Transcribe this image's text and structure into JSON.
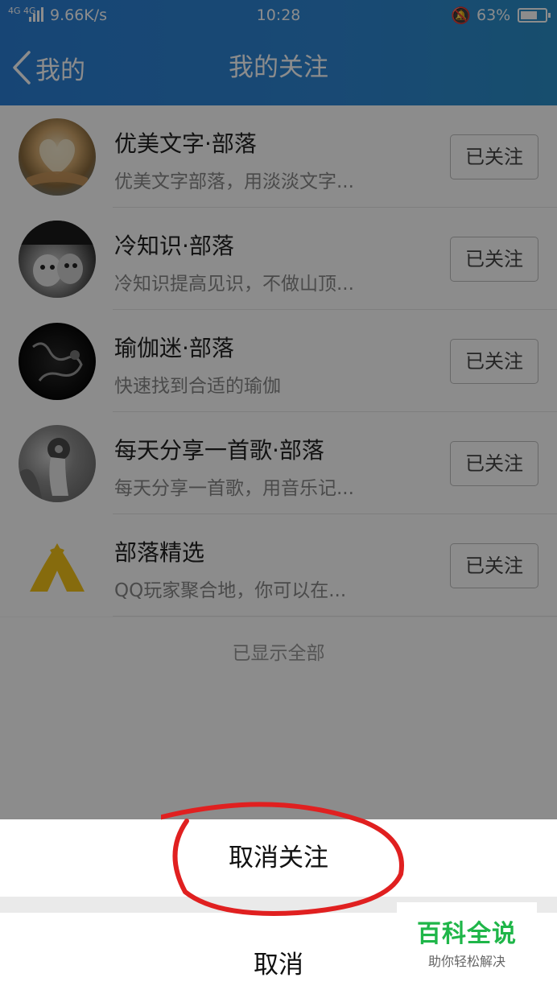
{
  "status_bar": {
    "network": "4G 4G",
    "speed": "9.66K/s",
    "time": "10:28",
    "battery": "63%"
  },
  "header": {
    "back_label": "我的",
    "title": "我的关注"
  },
  "list": {
    "items": [
      {
        "name": "优美文字·部落",
        "desc": "优美文字部落，用淡淡文字...",
        "button": "已关注",
        "avatar": "book-heart-avatar"
      },
      {
        "name": "冷知识·部落",
        "desc": "冷知识提高见识，不做山顶...",
        "button": "已关注",
        "avatar": "cartoon-avatar"
      },
      {
        "name": "瑜伽迷·部落",
        "desc": "快速找到合适的瑜伽",
        "button": "已关注",
        "avatar": "yoga-avatar"
      },
      {
        "name": "每天分享一首歌·部落",
        "desc": "每天分享一首歌，用音乐记...",
        "button": "已关注",
        "avatar": "music-avatar"
      },
      {
        "name": "部落精选",
        "desc": "QQ玩家聚合地，你可以在...",
        "button": "已关注",
        "avatar": "tent-avatar"
      }
    ],
    "footer": "已显示全部"
  },
  "sheet": {
    "unfollow": "取消关注",
    "cancel": "取消"
  },
  "watermark": {
    "title": "百科全说",
    "subtitle": "助你轻松解决"
  },
  "colors": {
    "header_bg": "#2e86d3",
    "annotation": "#e02020",
    "watermark_green": "#1fb649"
  }
}
